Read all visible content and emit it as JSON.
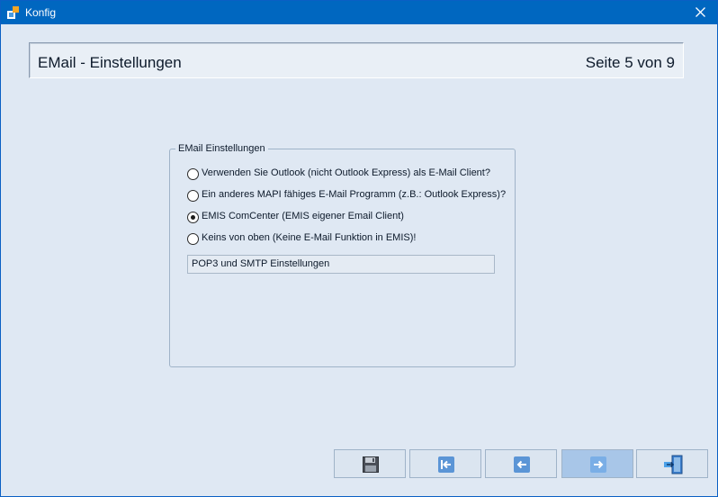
{
  "window": {
    "title": "Konfig"
  },
  "header": {
    "title": "EMail - Einstellungen",
    "page_indicator": "Seite 5 von 9"
  },
  "email_group": {
    "legend": "EMail Einstellungen",
    "options": [
      {
        "label": "Verwenden Sie Outlook (nicht Outlook Express) als E-Mail Client?",
        "selected": false
      },
      {
        "label": "Ein anderes MAPI fähiges E-Mail Programm (z.B.: Outlook Express)?",
        "selected": false
      },
      {
        "label": "EMIS ComCenter (EMIS eigener Email Client)",
        "selected": true
      },
      {
        "label": "Keins von oben (Keine E-Mail Funktion in EMIS)!",
        "selected": false
      }
    ],
    "pop3_button": "POP3 und SMTP Einstellungen"
  },
  "footer_buttons": {
    "items": [
      "save-icon",
      "first-page-icon",
      "previous-icon",
      "next-icon",
      "exit-door-icon"
    ],
    "active_index": 3
  },
  "colors": {
    "titlebar": "#0067c0",
    "window_bg": "#dfe8f3",
    "active_button": "#a8c6e8"
  }
}
